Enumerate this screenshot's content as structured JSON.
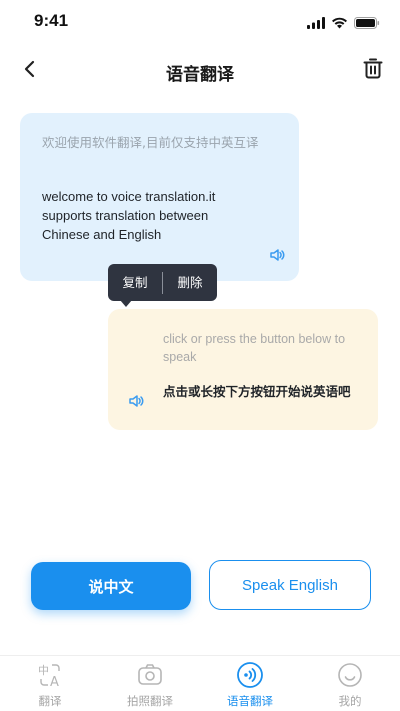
{
  "status_bar": {
    "time": "9:41",
    "icons": [
      "cellular-signal-icon",
      "wifi-icon",
      "battery-icon"
    ]
  },
  "nav": {
    "title": "语音翻译",
    "back_icon": "chevron-left-icon",
    "delete_icon": "trash-icon"
  },
  "conversation": [
    {
      "side": "left",
      "source_text": "欢迎使用软件翻译,目前仅支持中英互译",
      "translated_text": "welcome to voice translation.it supports translation between Chinese and English",
      "bubble_color": "#e2f1fd",
      "icon": "speaker-icon"
    },
    {
      "side": "right",
      "hint_text": "click or press the button below to speak",
      "main_text": "点击或长按下方按钮开始说英语吧",
      "bubble_color": "#fdf5e2",
      "icon": "speaker-icon"
    }
  ],
  "context_menu": {
    "items": [
      "复制",
      "删除"
    ]
  },
  "actions": {
    "chinese_button": "说中文",
    "english_button": "Speak English",
    "accent_color": "#1a8fee"
  },
  "tab_bar": {
    "items": [
      {
        "label": "翻译",
        "icon": "text-translate-icon",
        "active": false
      },
      {
        "label": "拍照翻译",
        "icon": "camera-icon",
        "active": false
      },
      {
        "label": "语音翻译",
        "icon": "voice-wave-icon",
        "active": true
      },
      {
        "label": "我的",
        "icon": "smiley-face-icon",
        "active": false
      }
    ]
  }
}
